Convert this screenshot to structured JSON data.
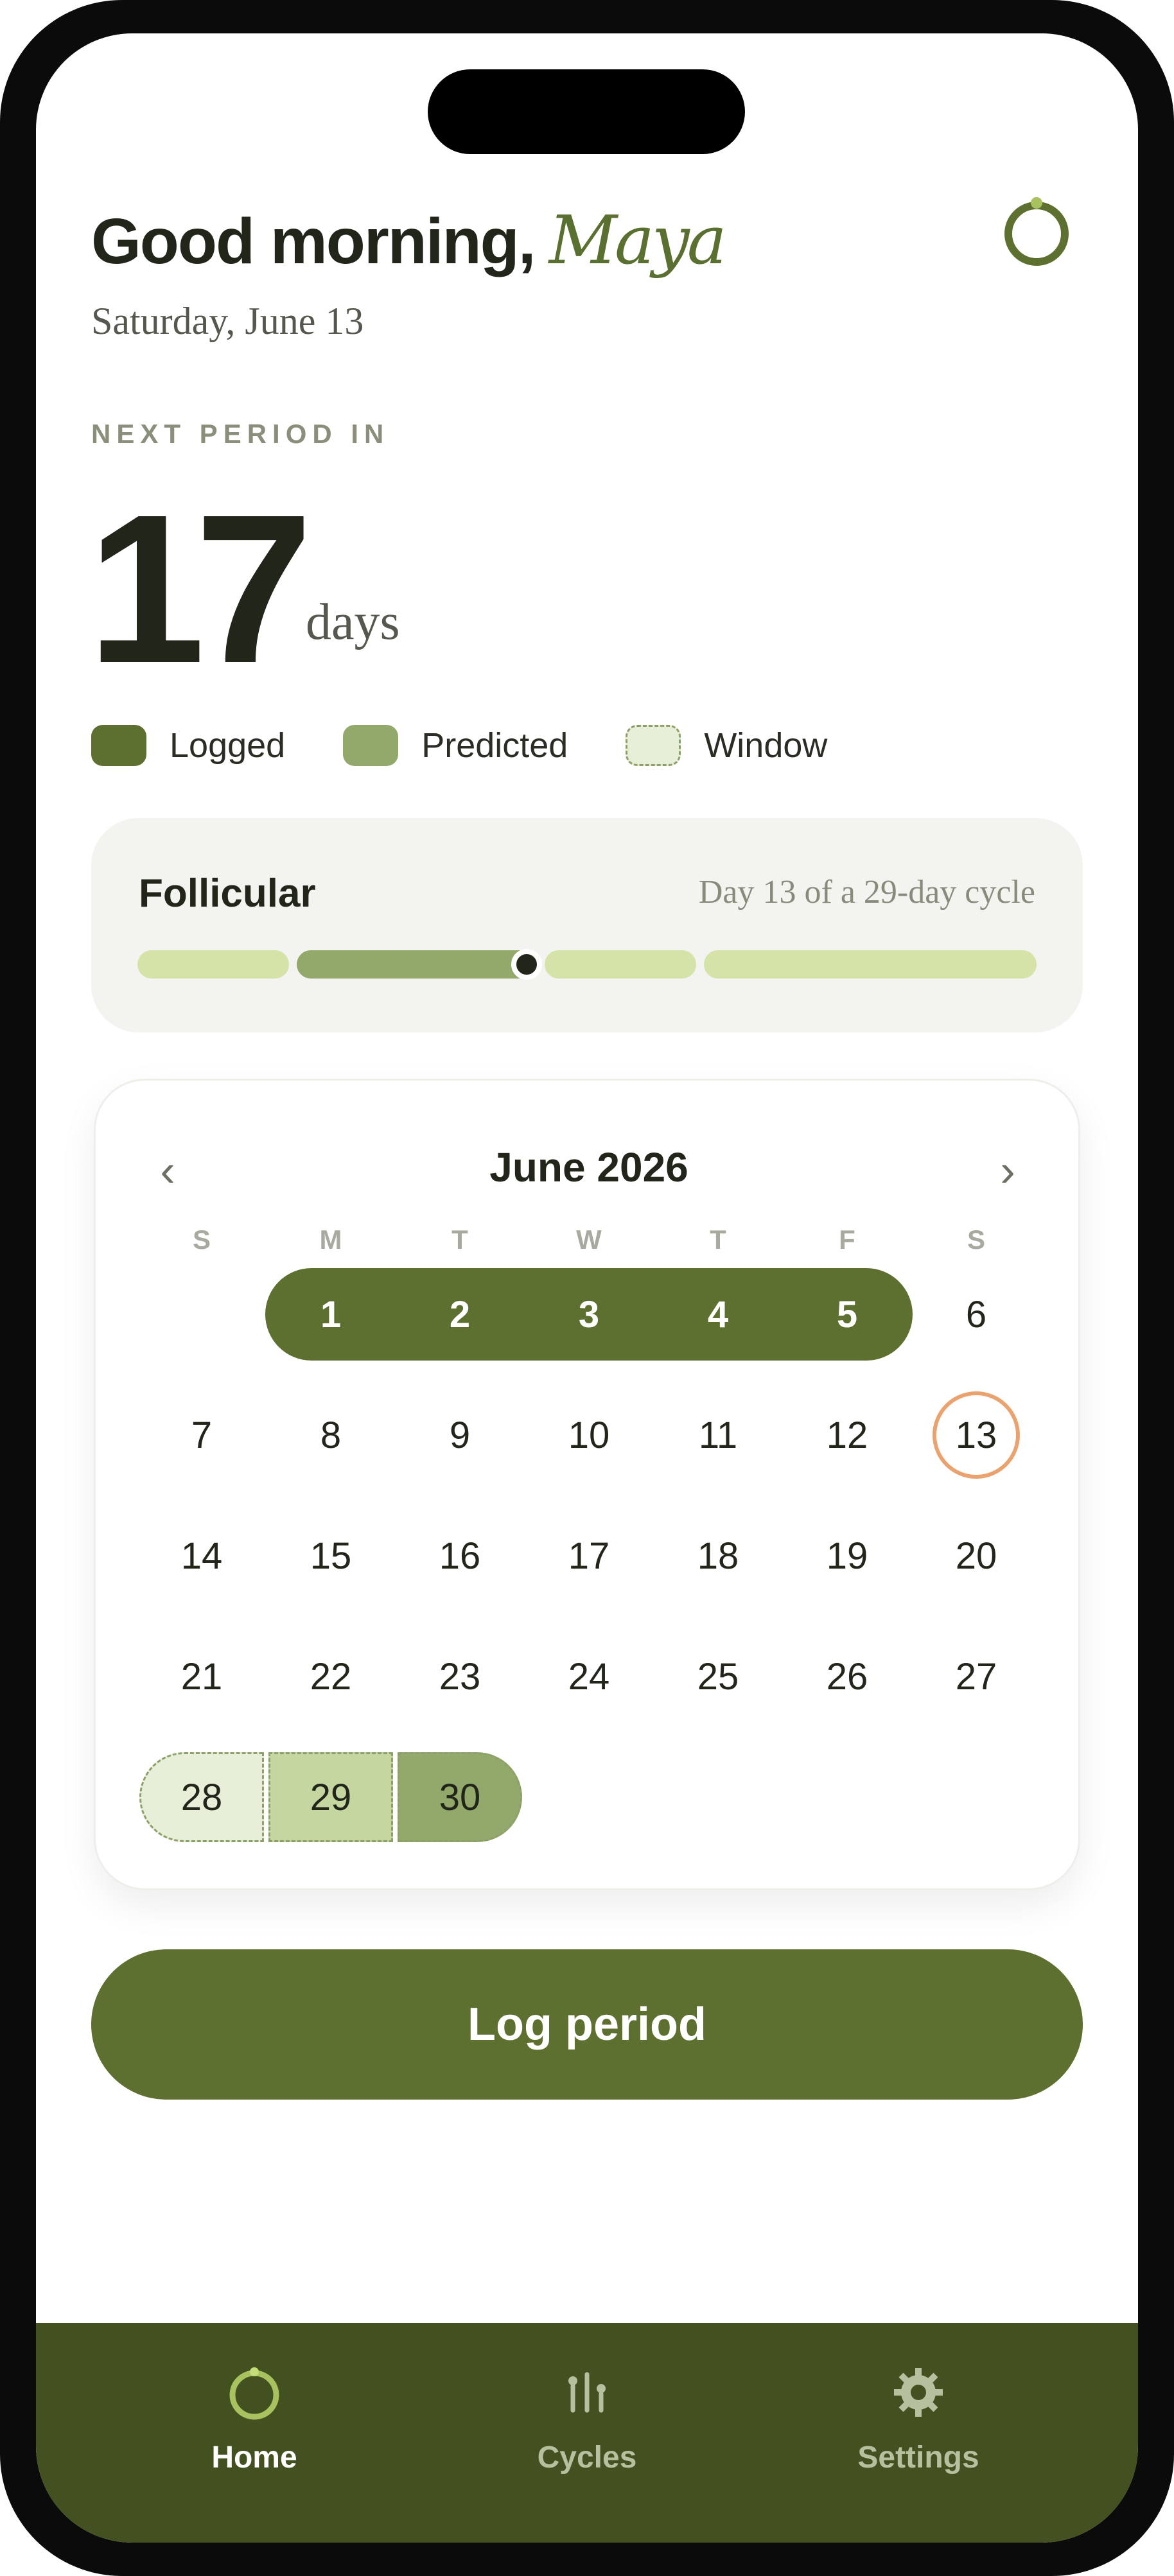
{
  "header": {
    "greeting": "Good morning,",
    "name": "Maya",
    "date": "Saturday, June 13"
  },
  "countdown": {
    "label": "NEXT PERIOD IN",
    "value": "17",
    "unit": "days"
  },
  "legend": [
    {
      "label": "Logged",
      "color": "#5d702f"
    },
    {
      "label": "Predicted",
      "color": "#93a86b"
    },
    {
      "label": "Window",
      "color": "#e8efd9"
    }
  ],
  "phase": {
    "name": "Follicular",
    "detail": "Day 13 of a 29-day cycle",
    "cycle_day": 13,
    "cycle_length": 29
  },
  "calendar": {
    "month_label": "June 2026",
    "prev_icon": "chevron-left-icon",
    "next_icon": "chevron-right-icon",
    "weekdays": [
      "S",
      "M",
      "T",
      "W",
      "T",
      "F",
      "S"
    ],
    "weeks": [
      [
        "",
        "1",
        "2",
        "3",
        "4",
        "5",
        "6"
      ],
      [
        "7",
        "8",
        "9",
        "10",
        "11",
        "12",
        "13"
      ],
      [
        "14",
        "15",
        "16",
        "17",
        "18",
        "19",
        "20"
      ],
      [
        "21",
        "22",
        "23",
        "24",
        "25",
        "26",
        "27"
      ],
      [
        "28",
        "29",
        "30",
        "",
        "",
        "",
        ""
      ]
    ],
    "logged_days": [
      1,
      2,
      3,
      4,
      5
    ],
    "today": 13,
    "window_days": [
      28
    ],
    "predicted_light_days": [
      29
    ],
    "predicted_days": [
      30
    ],
    "colors": {
      "logged": "#5d702f",
      "predicted": "#93a86b",
      "predicted_light": "#c6d6a0",
      "window": "#e8efd9",
      "today_ring": "#eaa26f"
    }
  },
  "action": {
    "log_label": "Log period"
  },
  "tabbar": {
    "tabs": [
      {
        "label": "Home",
        "icon": "power-ring-icon",
        "active": true
      },
      {
        "label": "Cycles",
        "icon": "sliders-icon",
        "active": false
      },
      {
        "label": "Settings",
        "icon": "gear-icon",
        "active": false
      }
    ]
  }
}
